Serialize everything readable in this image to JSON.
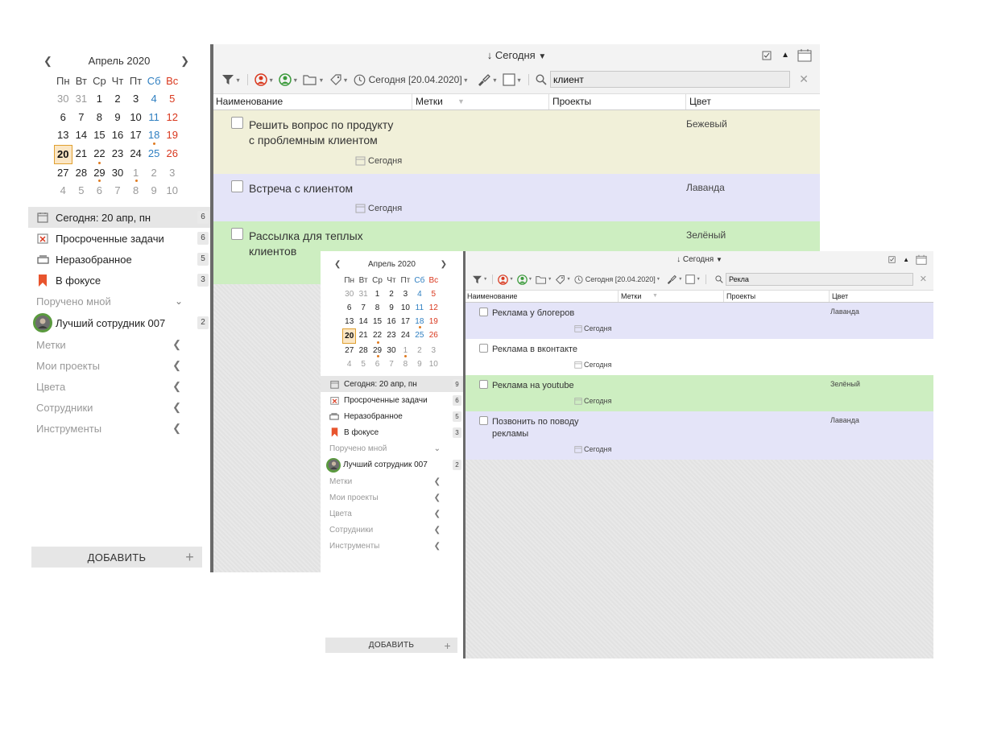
{
  "win1": {
    "calendar": {
      "month": "Апрель 2020",
      "dow": [
        "Пн",
        "Вт",
        "Ср",
        "Чт",
        "Пт",
        "Сб",
        "Вс"
      ],
      "days": [
        "30",
        "31",
        "1",
        "2",
        "3",
        "4",
        "5",
        "6",
        "7",
        "8",
        "9",
        "10",
        "11",
        "12",
        "13",
        "14",
        "15",
        "16",
        "17",
        "18",
        "19",
        "20",
        "21",
        "22",
        "23",
        "24",
        "25",
        "26",
        "27",
        "28",
        "29",
        "30",
        "1",
        "2",
        "3",
        "4",
        "5",
        "6",
        "7",
        "8",
        "9",
        "10"
      ]
    },
    "nav": {
      "today": {
        "label": "Сегодня: 20 апр, пн",
        "count": "6"
      },
      "overdue": {
        "label": "Просроченные задачи",
        "count": "6"
      },
      "inbox": {
        "label": "Неразобранное",
        "count": "5"
      },
      "focus": {
        "label": "В фокусе",
        "count": "3"
      },
      "assigned": {
        "label": "Поручено мной"
      },
      "employee": {
        "label": "Лучший сотрудник 007",
        "count": "2"
      },
      "tags": {
        "label": "Метки"
      },
      "projects": {
        "label": "Мои проекты"
      },
      "colors": {
        "label": "Цвета"
      },
      "staff": {
        "label": "Сотрудники"
      },
      "tools": {
        "label": "Инструменты"
      }
    },
    "add_label": "ДОБАВИТЬ",
    "sort_title": "Сегодня",
    "toolbar": {
      "date_filter": "Сегодня [20.04.2020]",
      "search_value": "клиент"
    },
    "columns": [
      "Наименование",
      "Метки",
      "Проекты",
      "Цвет"
    ],
    "tasks": [
      {
        "title": "Решить вопрос по продукту\nс проблемным клиентом",
        "color": "Бежевый",
        "due": "Сегодня"
      },
      {
        "title": "Встреча с клиентом",
        "color": "Лаванда",
        "due": "Сегодня"
      },
      {
        "title": "Рассылка для теплых\nклиентов",
        "color": "Зелёный",
        "due": ""
      }
    ]
  },
  "win2": {
    "calendar": {
      "month": "Апрель 2020",
      "dow": [
        "Пн",
        "Вт",
        "Ср",
        "Чт",
        "Пт",
        "Сб",
        "Вс"
      ],
      "days": [
        "30",
        "31",
        "1",
        "2",
        "3",
        "4",
        "5",
        "6",
        "7",
        "8",
        "9",
        "10",
        "11",
        "12",
        "13",
        "14",
        "15",
        "16",
        "17",
        "18",
        "19",
        "20",
        "21",
        "22",
        "23",
        "24",
        "25",
        "26",
        "27",
        "28",
        "29",
        "30",
        "1",
        "2",
        "3",
        "4",
        "5",
        "6",
        "7",
        "8",
        "9",
        "10"
      ]
    },
    "nav": {
      "today": {
        "label": "Сегодня: 20 апр, пн",
        "count": "9"
      },
      "overdue": {
        "label": "Просроченные задачи",
        "count": "6"
      },
      "inbox": {
        "label": "Неразобранное",
        "count": "5"
      },
      "focus": {
        "label": "В фокусе",
        "count": "3"
      },
      "assigned": {
        "label": "Поручено мной"
      },
      "employee": {
        "label": "Лучший сотрудник 007",
        "count": "2"
      },
      "tags": {
        "label": "Метки"
      },
      "projects": {
        "label": "Мои проекты"
      },
      "colors": {
        "label": "Цвета"
      },
      "staff": {
        "label": "Сотрудники"
      },
      "tools": {
        "label": "Инструменты"
      }
    },
    "add_label": "ДОБАВИТЬ",
    "sort_title": "Сегодня",
    "toolbar": {
      "date_filter": "Сегодня [20.04.2020]",
      "search_value": "Рекла"
    },
    "columns": [
      "Наименование",
      "Метки",
      "Проекты",
      "Цвет"
    ],
    "tasks": [
      {
        "title": "Реклама у блогеров",
        "color": "Лаванда",
        "due": "Сегодня"
      },
      {
        "title": "Реклама в вконтакте",
        "color": "",
        "due": "Сегодня"
      },
      {
        "title": "Реклама на youtube",
        "color": "Зелёный",
        "due": "Сегодня"
      },
      {
        "title": "Позвонить по поводу\nрекламы",
        "color": "Лаванда",
        "due": "Сегодня"
      }
    ]
  },
  "colors": {
    "today_highlight": "#fbe6c4",
    "saturday": "#2f7fc1",
    "sunday": "#d9381e",
    "overdue_icon": "#d9381e",
    "focus_icon": "#e8542d",
    "assigned_filter_icon": "#d9381e",
    "employee_filter_icon": "#3a9a3a"
  },
  "icons": {
    "calendar_nav": [
      "chevron-left-icon",
      "chevron-right-icon"
    ],
    "nav": [
      "calendar-today-icon",
      "overdue-icon",
      "inbox-tray-icon",
      "bookmark-icon",
      "avatar"
    ],
    "toolbar": [
      "filter-icon",
      "person-red-icon",
      "person-green-icon",
      "folder-icon",
      "tag-icon",
      "clock-icon",
      "brush-icon",
      "checkbox-square-icon",
      "search-icon",
      "clear-icon"
    ],
    "topright": [
      "checklist-icon",
      "collapse-up-icon",
      "calendar-view-icon"
    ]
  }
}
